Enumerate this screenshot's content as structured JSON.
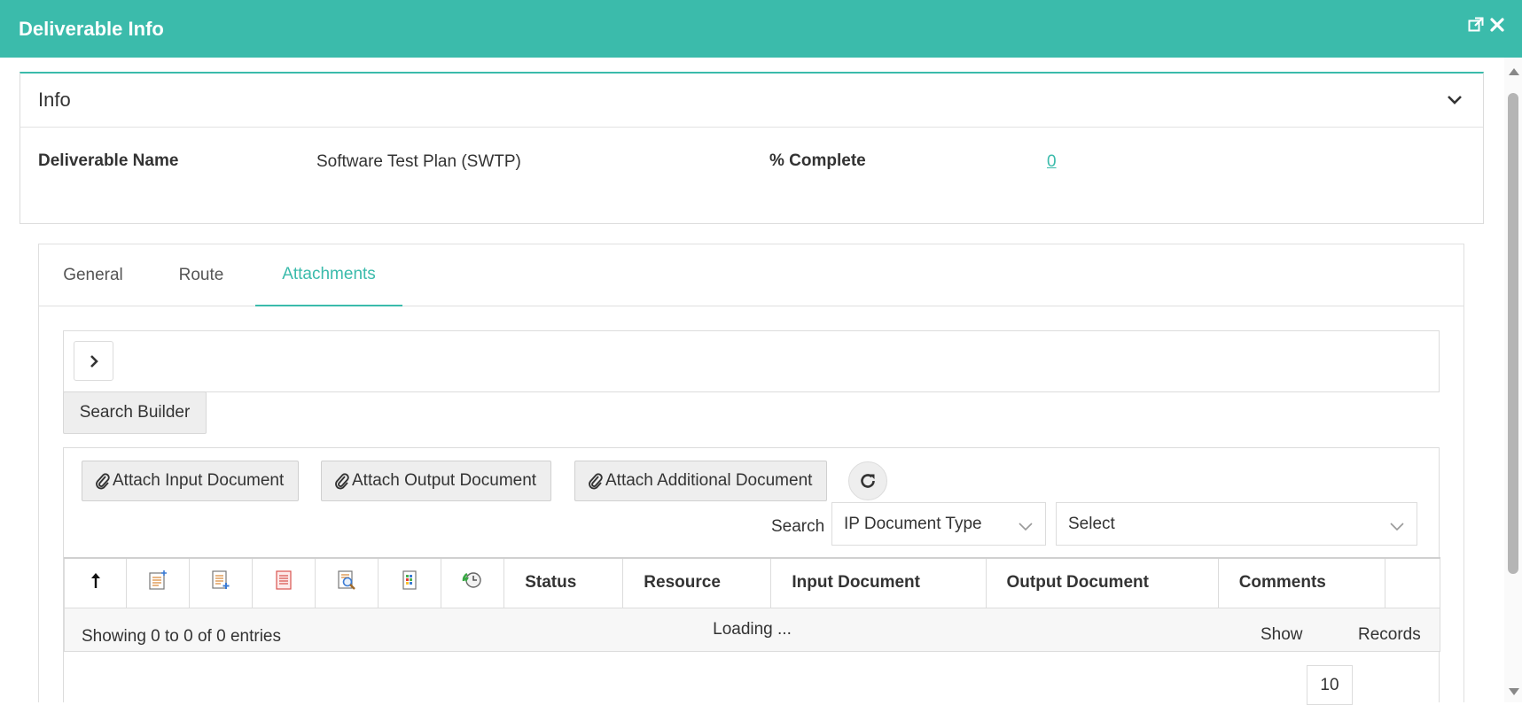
{
  "window": {
    "title": "Deliverable Info",
    "popout_icon": "external-link-icon",
    "close_icon": "close-icon"
  },
  "info": {
    "heading": "Info",
    "deliverable_name_label": "Deliverable Name",
    "deliverable_name_value": "Software Test Plan (SWTP)",
    "percent_complete_label": "% Complete",
    "percent_complete_value": "0"
  },
  "tabs": [
    {
      "label": "General",
      "active": false
    },
    {
      "label": "Route",
      "active": false
    },
    {
      "label": "Attachments",
      "active": true
    }
  ],
  "toolbar": {
    "search_builder_label": "Search Builder",
    "attach_input_label": "Attach Input Document",
    "attach_output_label": "Attach Output Document",
    "attach_additional_label": "Attach Additional Document",
    "search_label": "Search",
    "search_field_value": "IP Document Type",
    "search_value_placeholder": "Select"
  },
  "table": {
    "icon_columns": [
      "sort-up-icon",
      "new-document-icon",
      "add-document-icon",
      "pdf-document-icon",
      "view-document-icon",
      "excel-document-icon",
      "history-icon"
    ],
    "columns": [
      "Status",
      "Resource",
      "Input Document",
      "Output Document",
      "Comments"
    ],
    "loading_text": "Loading ..."
  },
  "footer": {
    "showing_text": "Showing 0 to 0 of 0 entries",
    "show_label": "Show",
    "page_size": "10",
    "records_label": "Records"
  },
  "colors": {
    "accent": "#3bbbab"
  }
}
